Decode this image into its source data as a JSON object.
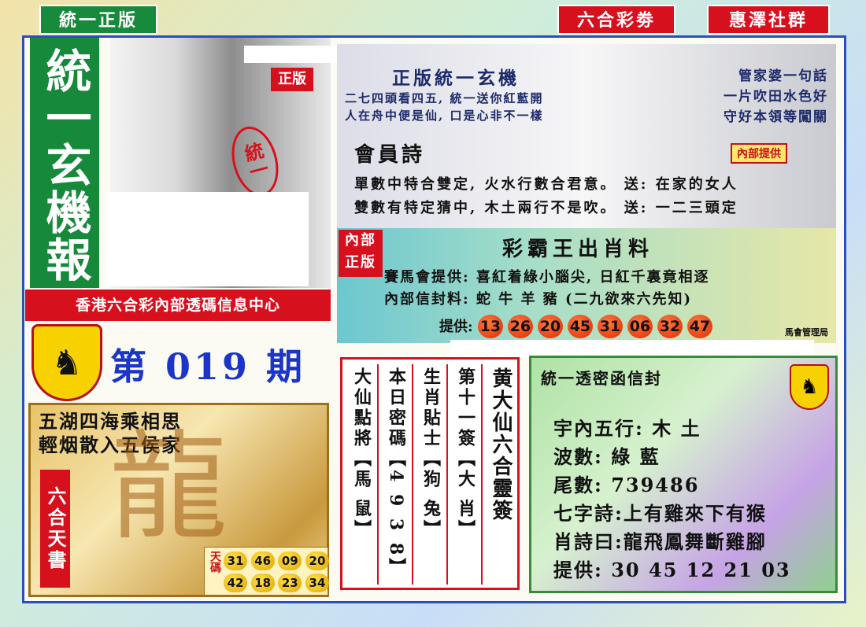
{
  "top_tags": {
    "left": "統一正版",
    "mid": "六合彩劵",
    "right": "惠澤社群"
  },
  "vertical_title": "統一玄機報",
  "stamp_genuine": "正版",
  "stamp_unified": "統一",
  "center_banner": "香港六合彩內部透碼信息中心",
  "issue_label": "第 019 期",
  "top_right": {
    "title": "正版統一玄機",
    "line1": "二七四頭看四五, 統一送你紅藍開",
    "line2": "人在舟中便是仙, 口是心非不一樣",
    "right_title": "管家婆一句話",
    "right_line1": "一片吹田水色好",
    "right_line2": "守好本領等闖關",
    "member_poem": "會員詩",
    "internal_badge": "內部提供",
    "verse1": "單數中特合雙定, 火水行數合君意。 送: 在家的女人",
    "verse2": "雙數有特定猜中, 木土兩行不是吹。 送: 一二三頭定"
  },
  "middle_right": {
    "tag": "內部正版",
    "title": "彩霸王出肖料",
    "line1": "賽馬會提供: 喜紅着綠小腦尖, 日紅千裏竟相逐",
    "line2": "內部信封料: 蛇 牛 羊 豬 (二九欲來六先知)",
    "provide_label": "提供:",
    "balls": [
      "13",
      "26",
      "20",
      "45",
      "31",
      "06",
      "32",
      "47"
    ],
    "mgmt": "馬會管理局"
  },
  "dragon": {
    "poem1": "五湖四海乘相思",
    "poem2": "輕烟散入五侯家",
    "book": "六合天書",
    "sky_label": "天碼",
    "row1": [
      "31",
      "46",
      "09",
      "20"
    ],
    "row2": [
      "42",
      "18",
      "23",
      "34"
    ]
  },
  "columns": [
    {
      "text": "大仙點將【馬 鼠】"
    },
    {
      "text": "本日密碼【4 9 3 8】"
    },
    {
      "text": "生肖貼士【狗 兔】"
    },
    {
      "text": "第十一簽【大 肖】"
    },
    {
      "text": "黄大仙六合靈簽"
    }
  ],
  "envelope": {
    "title": "統一透密函信封",
    "line1": "宇內五行: 木 土",
    "line2": "波數: 綠 藍",
    "line3": "尾數: 739486",
    "line4": "七字詩:上有雞來下有猴",
    "line5": "肖詩曰:龍飛鳳舞斷雞腳",
    "line6": "提供: 30 45 12 21 03"
  }
}
